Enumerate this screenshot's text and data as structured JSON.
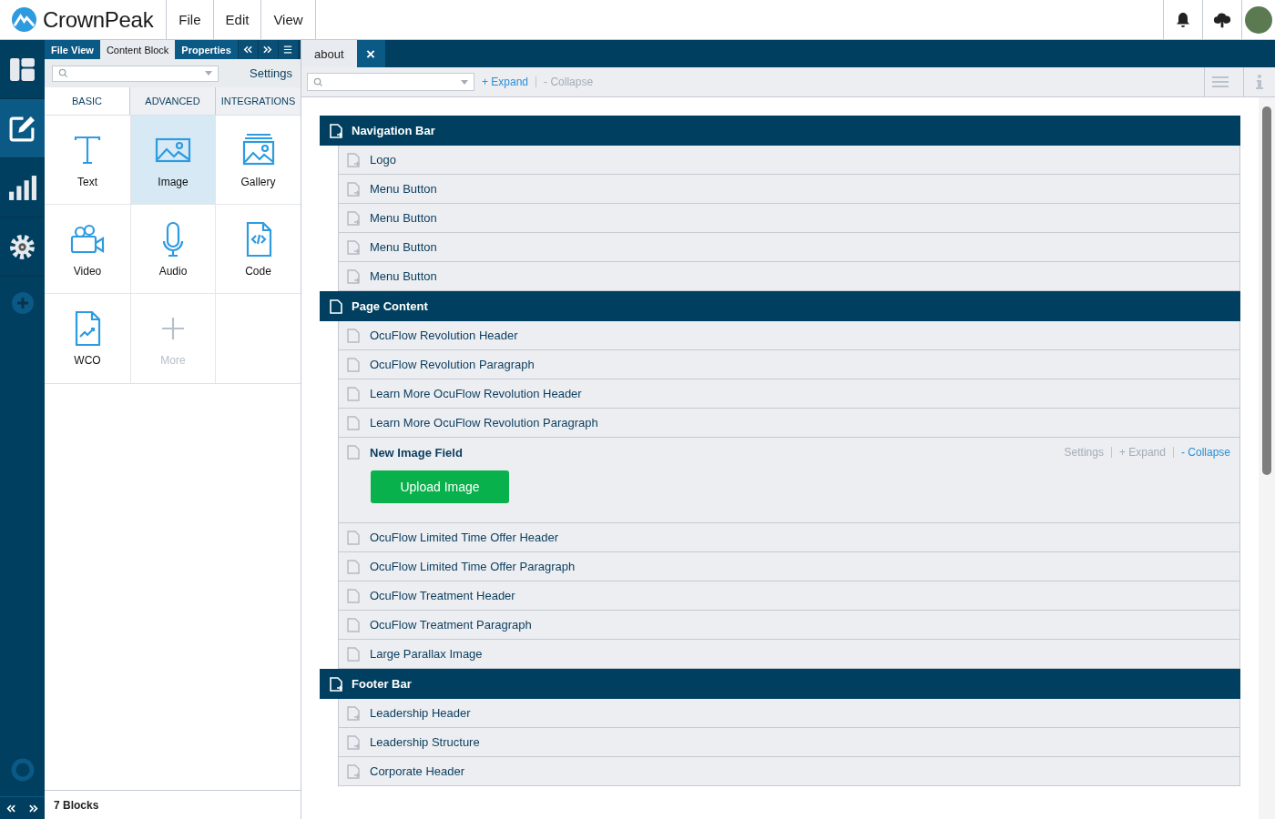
{
  "app": {
    "logo": "CrownPeak",
    "menu": [
      "File",
      "Edit",
      "View"
    ]
  },
  "rail": [
    {
      "kind": "layout",
      "selected": false
    },
    {
      "kind": "edit",
      "selected": true
    },
    {
      "kind": "chart",
      "selected": false
    },
    {
      "kind": "gear",
      "selected": false
    },
    {
      "kind": "add",
      "selected": false
    }
  ],
  "panel": {
    "tabs": [
      {
        "label": "File View",
        "selected": false
      },
      {
        "label": "Content Block",
        "selected": true
      },
      {
        "label": "Properties",
        "selected": false
      }
    ],
    "settings": "Settings",
    "categories": [
      {
        "label": "BASIC",
        "selected": true
      },
      {
        "label": "ADVANCED",
        "selected": false
      },
      {
        "label": "INTEGRATIONS",
        "selected": false
      }
    ],
    "blocks": [
      {
        "label": "Text",
        "kind": "text",
        "selected": false,
        "disabled": false
      },
      {
        "label": "Image",
        "kind": "image",
        "selected": true,
        "disabled": false
      },
      {
        "label": "Gallery",
        "kind": "gallery",
        "selected": false,
        "disabled": false
      },
      {
        "label": "Video",
        "kind": "video",
        "selected": false,
        "disabled": false
      },
      {
        "label": "Audio",
        "kind": "audio",
        "selected": false,
        "disabled": false
      },
      {
        "label": "Code",
        "kind": "code",
        "selected": false,
        "disabled": false
      },
      {
        "label": "WCO",
        "kind": "wco",
        "selected": false,
        "disabled": false
      },
      {
        "label": "More",
        "kind": "more",
        "selected": false,
        "disabled": true
      }
    ],
    "footer": "7 Blocks"
  },
  "document_tab": {
    "label": "about"
  },
  "toolbar": {
    "links": [
      {
        "label": "+ Expand",
        "disabled": false
      },
      {
        "label": "- Collapse",
        "disabled": true
      }
    ]
  },
  "sections": [
    {
      "title": "Navigation Bar",
      "linked": true,
      "children": [
        {
          "label": "Logo",
          "kind": "item",
          "linked": true
        },
        {
          "label": "Menu Button",
          "kind": "item",
          "linked": true
        },
        {
          "label": "Menu Button",
          "kind": "item",
          "linked": true
        },
        {
          "label": "Menu Button",
          "kind": "item",
          "linked": true
        },
        {
          "label": "Menu Button",
          "kind": "item",
          "linked": true
        }
      ]
    },
    {
      "title": "Page Content",
      "linked": false,
      "children": [
        {
          "label": "OcuFlow Revolution Header",
          "kind": "item",
          "linked": false
        },
        {
          "label": "OcuFlow Revolution Paragraph",
          "kind": "item",
          "linked": false
        },
        {
          "label": "Learn More OcuFlow Revolution Header",
          "kind": "item",
          "linked": false
        },
        {
          "label": "Learn More OcuFlow Revolution Paragraph",
          "kind": "item",
          "linked": false
        },
        {
          "label": "New Image Field",
          "kind": "image_field",
          "linked": false,
          "button": "Upload Image",
          "actions": [
            {
              "label": "Settings",
              "disabled": true
            },
            {
              "label": "+ Expand",
              "disabled": true
            },
            {
              "label": "- Collapse",
              "disabled": false
            }
          ]
        },
        {
          "label": "OcuFlow Limited Time Offer Header",
          "kind": "item",
          "linked": false
        },
        {
          "label": "OcuFlow Limited Time Offer Paragraph",
          "kind": "item",
          "linked": false
        },
        {
          "label": "OcuFlow Treatment Header",
          "kind": "item",
          "linked": false
        },
        {
          "label": "OcuFlow Treatment Paragraph",
          "kind": "item",
          "linked": false
        },
        {
          "label": "Large Parallax Image",
          "kind": "item",
          "linked": false
        }
      ]
    },
    {
      "title": "Footer Bar",
      "linked": true,
      "children": [
        {
          "label": "Leadership Header",
          "kind": "item",
          "linked": true
        },
        {
          "label": "Leadership Structure",
          "kind": "item",
          "linked": true
        },
        {
          "label": "Corporate Header",
          "kind": "item",
          "linked": true
        }
      ]
    }
  ]
}
